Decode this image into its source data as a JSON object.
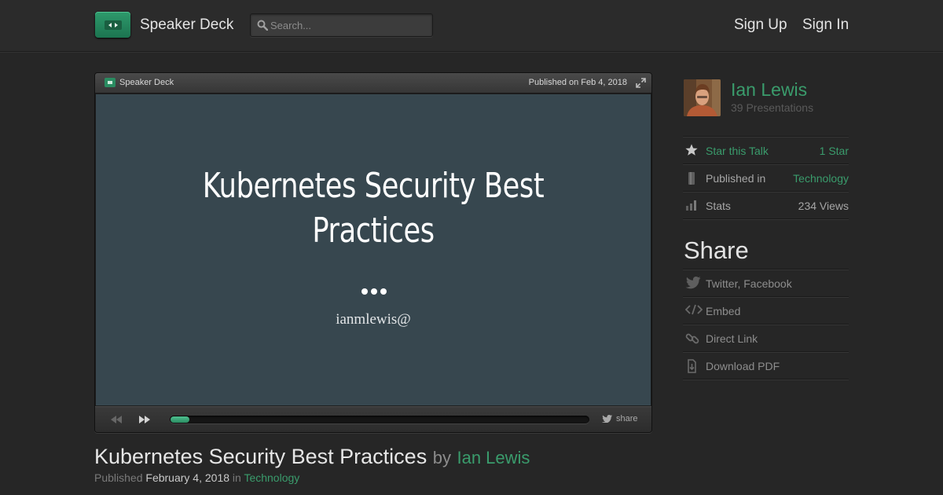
{
  "header": {
    "brand": "Speaker Deck",
    "search_placeholder": "Search...",
    "signup": "Sign Up",
    "signin": "Sign In"
  },
  "player": {
    "brand": "Speaker Deck",
    "published": "Published on Feb 4, 2018",
    "slide": {
      "title": "Kubernetes Security Best Practices",
      "handle": "ianmlewis@"
    },
    "progress_fraction": 0.045,
    "share_label": "share"
  },
  "talk": {
    "title": "Kubernetes Security Best Practices",
    "by": "by",
    "author": "Ian Lewis",
    "published_label": "Published",
    "date": "February 4, 2018",
    "in_label": "in",
    "category": "Technology"
  },
  "sidebar": {
    "author_name": "Ian Lewis",
    "presentations": "39 Presentations",
    "stats": [
      {
        "label": "Star this Talk",
        "value": "1 Star",
        "icon": "star-icon"
      },
      {
        "label": "Published in",
        "value": "Technology",
        "icon": "bookmark-icon"
      },
      {
        "label": "Stats",
        "value": "234 Views",
        "icon": "bar-chart-icon"
      }
    ],
    "share_heading": "Share",
    "share_items": [
      {
        "label": "Twitter, Facebook",
        "icon": "twitter-icon"
      },
      {
        "label": "Embed",
        "icon": "code-icon"
      },
      {
        "label": "Direct Link",
        "icon": "link-icon"
      },
      {
        "label": "Download PDF",
        "icon": "download-icon"
      }
    ]
  },
  "colors": {
    "accent": "#3a9c6c",
    "background": "#262626",
    "slide_background": "#37474f"
  }
}
